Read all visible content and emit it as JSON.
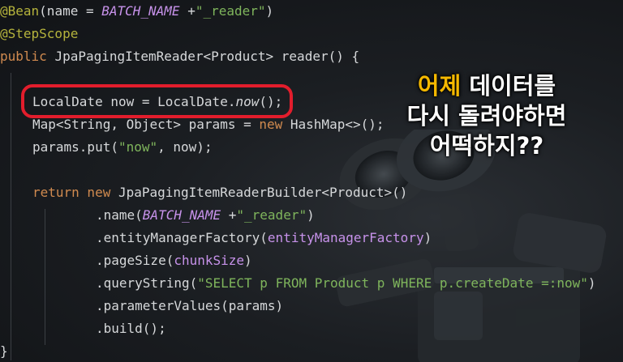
{
  "code": {
    "l1": {
      "ann": "@Bean",
      "a": "(name = ",
      "const": "BATCH_NAME",
      "b": " +",
      "str": "\"_reader\"",
      "c": ")"
    },
    "l2": {
      "ann": "@StepScope"
    },
    "l3": {
      "kw": "public ",
      "a": "JpaPagingItemReader<Product> reader() {"
    },
    "l4": {
      "a": "LocalDate now = LocalDate.",
      "m": "now",
      "b": "();"
    },
    "l5": {
      "a": "Map<String, Object> params = ",
      "kw": "new",
      "b": " HashMap<>();"
    },
    "l6": {
      "a": "params.put(",
      "str": "\"now\"",
      "b": ", now);"
    },
    "l7": {
      "kw": "return new",
      "a": " JpaPagingItemReaderBuilder<Product>()"
    },
    "l8": {
      "a": ".name(",
      "const": "BATCH_NAME",
      "b": " +",
      "str": "\"_reader\"",
      "c": ")"
    },
    "l9": {
      "a": ".entityManagerFactory(",
      "p": "entityManagerFactory",
      "b": ")"
    },
    "l10": {
      "a": ".pageSize(",
      "p": "chunkSize",
      "b": ")"
    },
    "l11": {
      "a": ".queryString(",
      "str": "\"SELECT p FROM Product p WHERE p.createDate =:now\"",
      "b": ")"
    },
    "l12": {
      "a": ".parameterValues(params)"
    },
    "l13": {
      "a": ".build();"
    },
    "l14": {
      "a": "}"
    }
  },
  "caption": {
    "line1_accent": "어제",
    "line1_rest": " 데이터를",
    "line2": "다시 돌려야하면",
    "line3": "어떡하지??"
  },
  "colors": {
    "annotation": "#b5b33c",
    "keyword": "#d08a4f",
    "string": "#7fb55c",
    "parameter": "#c792ea",
    "highlight_box": "#e21d2c",
    "caption_accent": "#f5b800"
  },
  "icons": [
    "robot-illustration"
  ]
}
